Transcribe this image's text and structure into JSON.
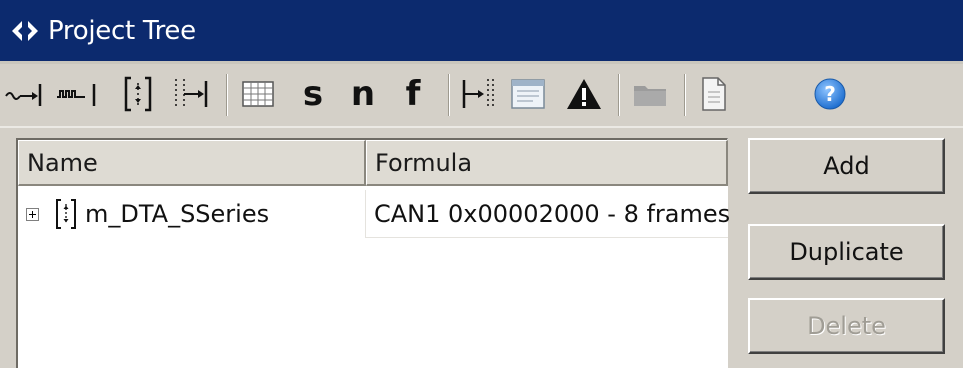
{
  "window": {
    "title": "Project Tree",
    "title_icon": "code-brackets-icon"
  },
  "toolbar": {
    "tools": [
      {
        "name": "signal-tool",
        "icon": "signal-arrow-icon"
      },
      {
        "name": "waveform-tool",
        "icon": "waveform-icon"
      },
      {
        "name": "frame-series-tool",
        "icon": "frame-bracket-icon"
      },
      {
        "name": "split-frame-tool",
        "icon": "split-frame-icon"
      },
      {
        "name": "table-tool",
        "icon": "grid-icon"
      },
      {
        "name": "s-tool",
        "label": "s"
      },
      {
        "name": "n-tool",
        "label": "n"
      },
      {
        "name": "f-tool",
        "label": "f"
      },
      {
        "name": "frame-arrow-tool",
        "icon": "frame-arrow-icon"
      },
      {
        "name": "window-tool",
        "icon": "window-icon"
      },
      {
        "name": "warning-tool",
        "icon": "warning-icon"
      },
      {
        "name": "folder-tool",
        "icon": "folder-icon",
        "disabled": true
      },
      {
        "name": "document-tool",
        "icon": "document-icon"
      },
      {
        "name": "help-tool",
        "icon": "help-icon"
      }
    ]
  },
  "tree": {
    "columns": [
      "Name",
      "Formula"
    ],
    "rows": [
      {
        "name": "m_DTA_SSeries",
        "formula": "CAN1 0x00002000 - 8 frames",
        "expanded": false,
        "icon": "frame-bracket-icon"
      }
    ]
  },
  "buttons": {
    "add": "Add",
    "duplicate": "Duplicate",
    "delete": "Delete"
  },
  "colors": {
    "titlebar": "#0c2a6e",
    "help_icon": "#1f6fd0"
  }
}
